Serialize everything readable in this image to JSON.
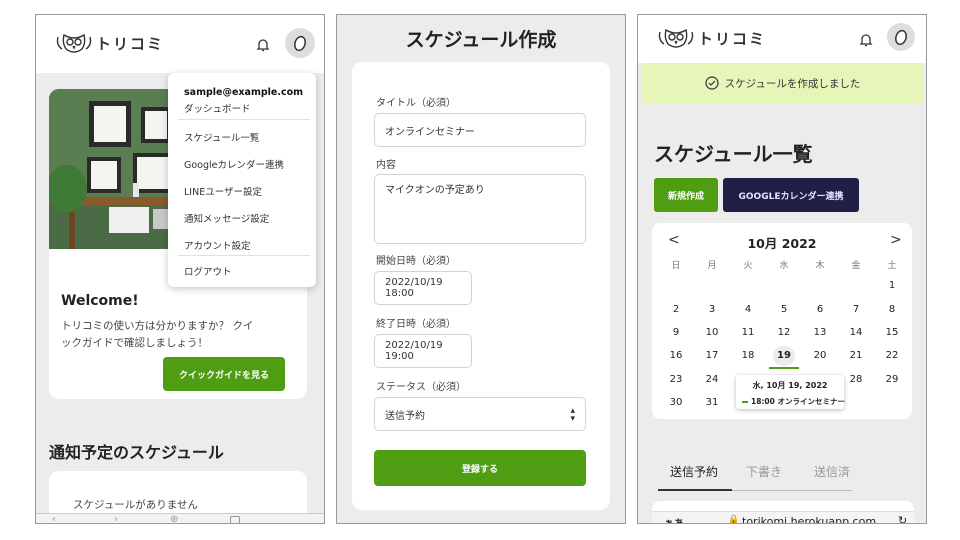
{
  "app_name": "トリコミ",
  "colors": {
    "brand_green": "#4f9d12",
    "google_navy": "#1f2046",
    "success_bg": "#e6f5b8"
  },
  "screen1": {
    "hero_title": "Welcome!",
    "hero_text_line1": "トリコミの使い方は分かりますか？ クイ",
    "hero_text_line2": "ックガイドで確認しましょう！",
    "quick_guide_button": "クイックガイドを見る",
    "section_title": "通知予定のスケジュール",
    "empty_text": "スケジュールがありません",
    "menu": {
      "email": "sample@example.com",
      "dashboard": "ダッシュボード",
      "items": [
        "スケジュール一覧",
        "Googleカレンダー連携",
        "LINEユーザー設定",
        "通知メッセージ設定",
        "アカウント設定"
      ],
      "logout": "ログアウト"
    }
  },
  "screen2": {
    "page_title": "スケジュール作成",
    "title_label": "タイトル（必須）",
    "title_value": "オンラインセミナー",
    "content_label": "内容",
    "content_value": "マイクオンの予定あり",
    "start_label": "開始日時（必須）",
    "start_value": "2022/10/19 18:00",
    "end_label": "終了日時（必須）",
    "end_value": "2022/10/19 19:00",
    "status_label": "ステータス（必須）",
    "status_value": "送信予約",
    "submit_button": "登録する"
  },
  "screen3": {
    "success_message": "スケジュールを作成しました",
    "page_title": "スケジュール一覧",
    "new_button": "新規作成",
    "google_button": "GOOGLEカレンダー連携",
    "calendar": {
      "prev": "<",
      "next": ">",
      "month_label": "10月 2022",
      "weekdays": [
        "日",
        "月",
        "火",
        "水",
        "木",
        "金",
        "土"
      ],
      "selected_day": 19,
      "tooltip_title": "水, 10月 19, 2022",
      "tooltip_event": "18:00 オンラインセミナー"
    },
    "tabs": [
      "送信予約",
      "下書き",
      "送信済"
    ],
    "active_tab": "送信予約",
    "browser_bar": {
      "aa": "ぁあ",
      "url": "torikomi.herokuapp.com"
    }
  }
}
